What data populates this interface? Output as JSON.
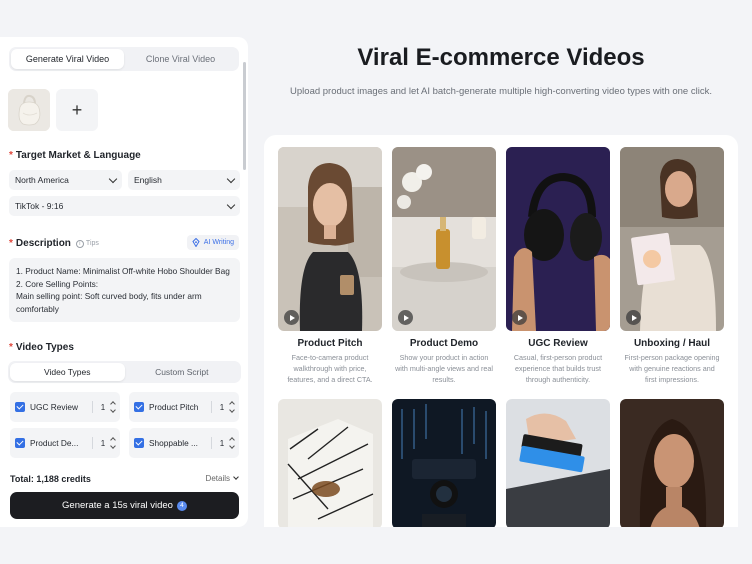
{
  "left_panel": {
    "mode_tabs": [
      {
        "label": "Generate Viral Video",
        "active": true
      },
      {
        "label": "Clone Viral Video",
        "active": false
      }
    ],
    "add_tile_label": "+",
    "market_section": {
      "title": "Target Market & Language",
      "region": "North America",
      "language": "English",
      "platform": "TikTok - 9:16"
    },
    "description_section": {
      "title": "Description",
      "tips_label": "Tips",
      "ai_button": "AI Writing",
      "text": "1. Product Name: Minimalist Off-white Hobo Shoulder Bag\n2. Core Selling Points:\nMain selling point: Soft curved body, fits under arm comfortably"
    },
    "video_types_section": {
      "title": "Video Types",
      "tabs": [
        {
          "label": "Video Types",
          "active": true
        },
        {
          "label": "Custom Script",
          "active": false
        }
      ],
      "items": [
        {
          "label": "UGC Review",
          "count": "1",
          "checked": true
        },
        {
          "label": "Product Pitch",
          "count": "1",
          "checked": true
        },
        {
          "label": "Product De...",
          "count": "1",
          "checked": true
        },
        {
          "label": "Shoppable ...",
          "count": "1",
          "checked": true
        }
      ]
    },
    "total_label": "Total: 1,188 credits",
    "details_label": "Details",
    "generate_button": "Generate a 15s viral video",
    "generate_badge": "4"
  },
  "hero": {
    "title": "Viral E-commerce Videos",
    "subtitle": "Upload product images and let AI batch-generate multiple high-converting video types with one click."
  },
  "gallery": {
    "cards": [
      {
        "title": "Product Pitch",
        "desc": "Face-to-camera product walkthrough with price, features, and a direct CTA."
      },
      {
        "title": "Product Demo",
        "desc": "Show your product in action with multi-angle views and real results."
      },
      {
        "title": "UGC Review",
        "desc": "Casual, first-person product experience that builds trust through authenticity."
      },
      {
        "title": "Unboxing / Haul",
        "desc": "First-person package opening with genuine reactions and first impressions."
      }
    ],
    "accent_color": "#3470e4"
  }
}
